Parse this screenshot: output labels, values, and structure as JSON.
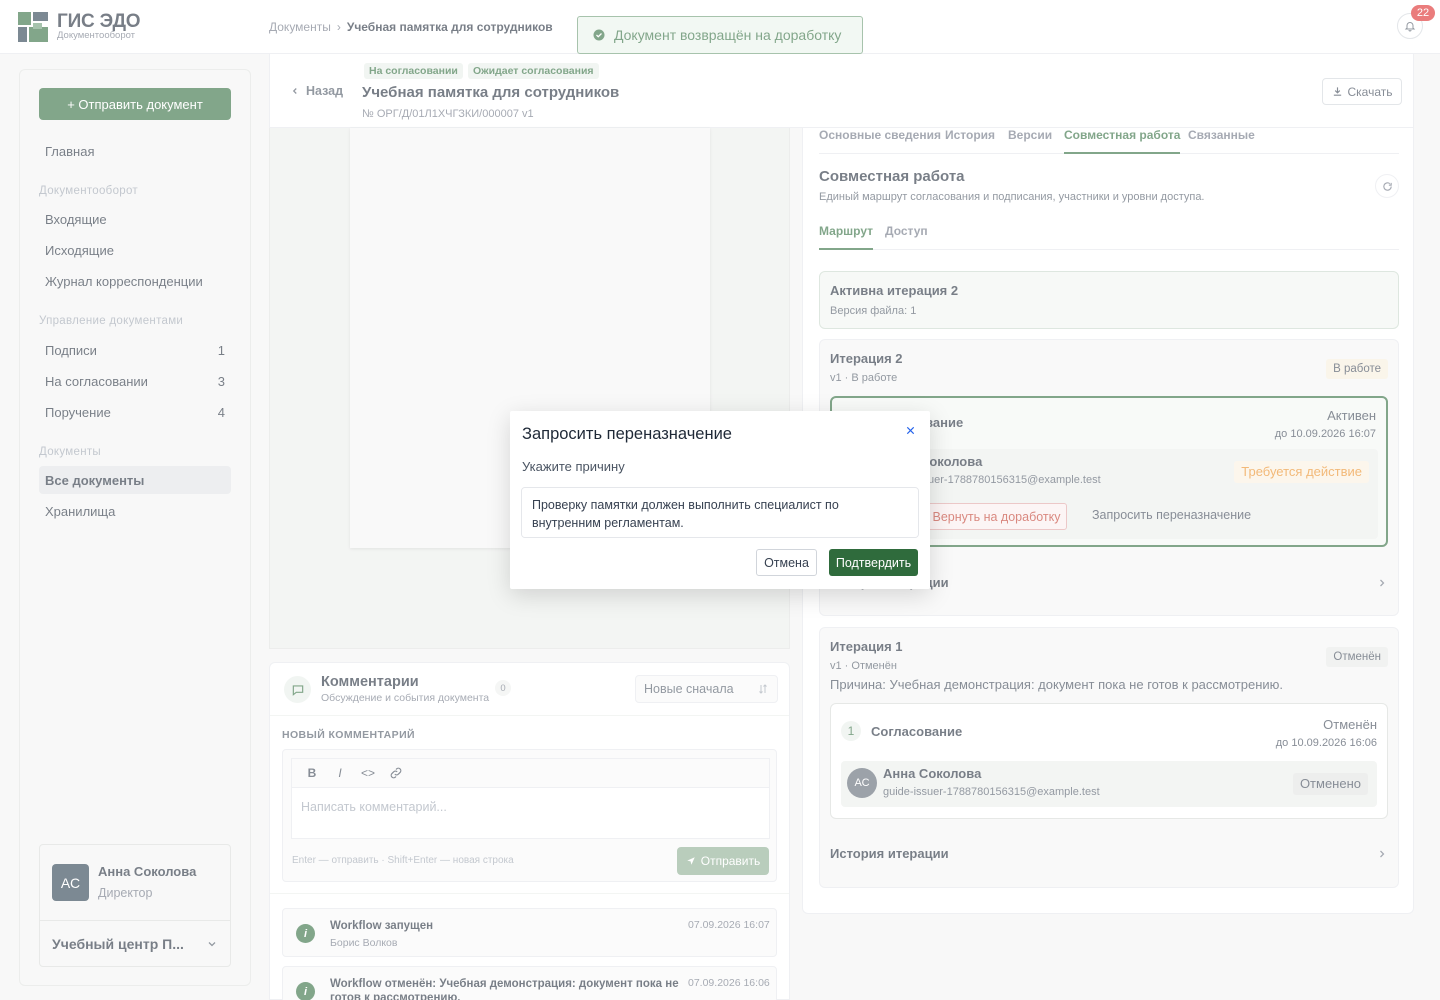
{
  "app": {
    "title": "ГИС ЭДО",
    "subtitle": "Документооборот"
  },
  "breadcrumb": {
    "root": "Документы",
    "sep": "›",
    "current": "Учебная памятка для сотрудников"
  },
  "notifications": {
    "count": "22"
  },
  "toast": {
    "text": "Документ возвращён на доработку"
  },
  "sidebar": {
    "send_button": "+ Отправить документ",
    "home": "Главная",
    "groups": [
      {
        "title": "Документооборот",
        "items": [
          {
            "label": "Входящие",
            "count": ""
          },
          {
            "label": "Исходящие",
            "count": ""
          },
          {
            "label": "Журнал корреспонденции",
            "count": ""
          }
        ]
      },
      {
        "title": "Управление документами",
        "items": [
          {
            "label": "Подписи",
            "count": "1"
          },
          {
            "label": "На согласовании",
            "count": "3"
          },
          {
            "label": "Поручение",
            "count": "4"
          }
        ]
      },
      {
        "title": "Документы",
        "items": [
          {
            "label": "Все документы",
            "count": ""
          },
          {
            "label": "Хранилища",
            "count": ""
          }
        ]
      }
    ],
    "user": {
      "initials": "АС",
      "name": "Анна Соколова",
      "role": "Директор",
      "org": "Учебный центр П..."
    }
  },
  "doc": {
    "back": "Назад",
    "chips": [
      "На согласовании",
      "Ожидает согласования"
    ],
    "title": "Учебная памятка для сотрудников",
    "number": "№ ОРГ/Д/01Л1ХЧГЗКИ/000007  v1",
    "download": "Скачать"
  },
  "comments": {
    "title": "Комментарии",
    "subtitle": "Обсуждение и события документа",
    "count": "0",
    "sort": "Новые сначала",
    "new_label": "НОВЫЙ КОММЕНТАРИЙ",
    "toolbar": [
      "B",
      "I",
      "<>"
    ],
    "placeholder": "Написать комментарий...",
    "hint": "Enter — отправить · Shift+Enter — новая строка",
    "send": "Отправить",
    "events": [
      {
        "title": "Workflow запущен",
        "author": "Борис Волков",
        "time": "07.09.2026 16:07"
      },
      {
        "title": "Workflow отменён: Учебная демонстрация: документ пока не готов к рассмотрению.",
        "author": "",
        "time": "07.09.2026 16:06"
      }
    ]
  },
  "panel": {
    "tabs": [
      "Основные сведения",
      "История",
      "Версии",
      "Совместная работа",
      "Связанные"
    ],
    "title": "Совместная работа",
    "subtitle": "Единый маршрут согласования и подписания, участники и уровни доступа.",
    "subtabs": [
      "Маршрут",
      "Доступ"
    ],
    "active_iteration": {
      "title": "Активна итерация 2",
      "sub": "Версия файла: 1"
    },
    "iteration2": {
      "title": "Итерация 2",
      "sub": "v1 · В работе",
      "badge": "В работе",
      "stage_name": "Согласование",
      "stage_status": "Активен",
      "deadline": "до 10.09.2026 16:07",
      "person": "Анна Соколова",
      "email": "guide-issuer-1788780156315@example.test",
      "person_badge": "Требуется действие",
      "return_btn": "Вернуть на доработку",
      "reassign_btn": "Запросить переназначение",
      "history": "История итерации"
    },
    "iteration1": {
      "title": "Итерация 1",
      "sub": "v1 · Отменён",
      "badge": "Отменён",
      "reason": "Причина: Учебная демонстрация: документ пока не готов к рассмотрению.",
      "stage_num": "1",
      "stage_name": "Согласование",
      "stage_status": "Отменён",
      "deadline": "до 10.09.2026 16:06",
      "person_initials": "АС",
      "person": "Анна Соколова",
      "email": "guide-issuer-1788780156315@example.test",
      "person_badge": "Отменено",
      "history": "История итерации"
    }
  },
  "modal": {
    "title": "Запросить переназначение",
    "label": "Укажите причину",
    "reason": "Проверку памятки должен выполнить специалист по внутренним регламентам.",
    "cancel": "Отмена",
    "confirm": "Подтвердить"
  },
  "colors": {
    "brand": "#2f6b3c",
    "danger": "#dc2626",
    "warning": "#ea8a1e"
  }
}
